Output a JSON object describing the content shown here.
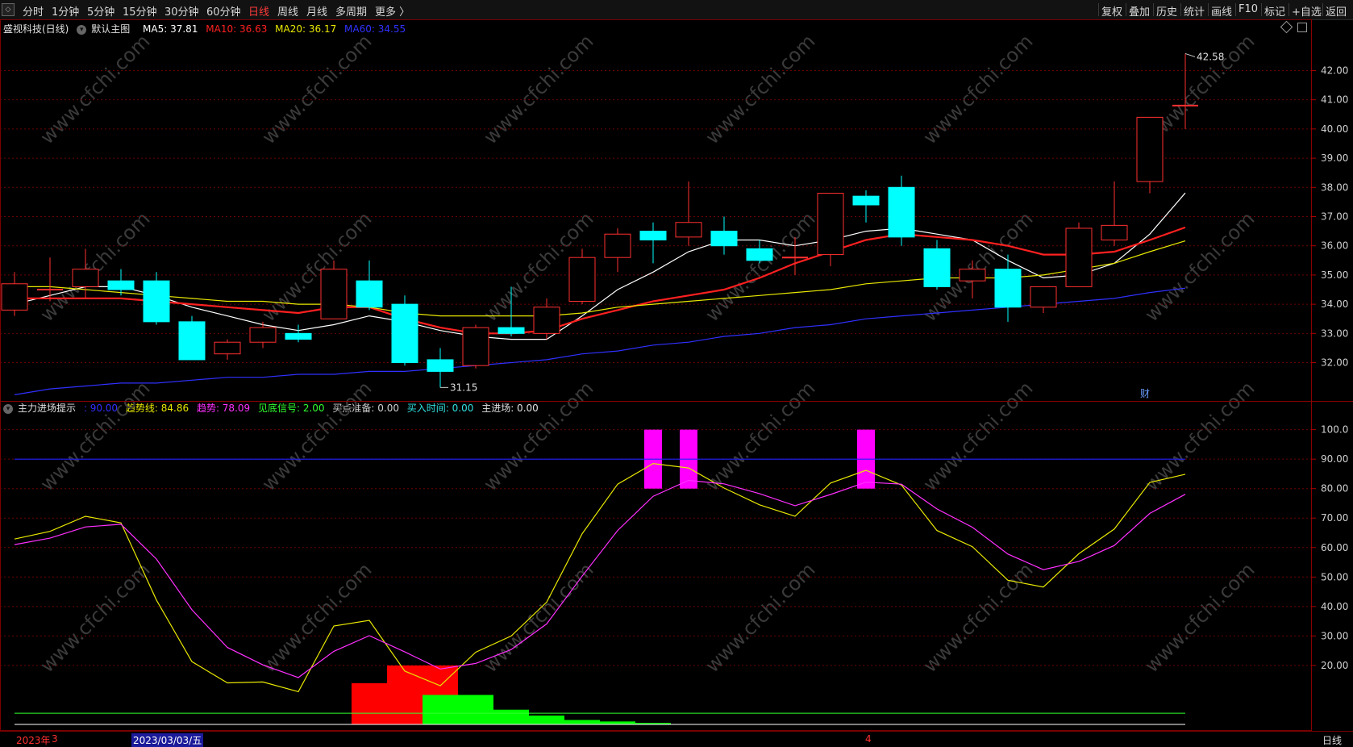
{
  "topbar": {
    "periods": [
      {
        "label": "分时",
        "active": false
      },
      {
        "label": "1分钟",
        "active": false
      },
      {
        "label": "5分钟",
        "active": false
      },
      {
        "label": "15分钟",
        "active": false
      },
      {
        "label": "30分钟",
        "active": false
      },
      {
        "label": "60分钟",
        "active": false
      },
      {
        "label": "日线",
        "active": true
      },
      {
        "label": "周线",
        "active": false
      },
      {
        "label": "月线",
        "active": false
      },
      {
        "label": "多周期",
        "active": false
      },
      {
        "label": "更多 〉",
        "active": false
      }
    ],
    "right_buttons": [
      "复权",
      "叠加",
      "历史",
      "统计",
      "画线",
      "F10",
      "标记",
      "+自选",
      "返回"
    ]
  },
  "main_legend": {
    "stock": "盛视科技(日线)",
    "template": "默认主图",
    "ma5": "MA5: 37.81",
    "ma10": "MA10: 36.63",
    "ma20": "MA20: 36.17",
    "ma60": "MA60: 34.55",
    "colors": {
      "ma5": "#ffffff",
      "ma10": "#ff2020",
      "ma20": "#e8e800",
      "ma60": "#3030ff"
    }
  },
  "indicator_legend": {
    "name": "主力进场提示",
    "level": ": 90.00",
    "trend_line": "趋势线: 84.86",
    "trend": "趋势: 78.09",
    "bottom_signal": "见底信号: 2.00",
    "buy_prep": "买点准备: 0.00",
    "buy_time": "买入时间: 0.00",
    "main_entry": "主进场: 0.00"
  },
  "annotations": {
    "high": "42.58",
    "low": "31.15",
    "cai": "财"
  },
  "watermark": "www.cfchi.com",
  "bottombar": {
    "year": "2023年",
    "m3": "3",
    "date": "2023/03/03/五",
    "m4": "4",
    "period": "日线"
  },
  "chart_data": [
    {
      "type": "candlestick",
      "title": "盛视科技(日线)",
      "y_ticks": [
        "32.00",
        "33.00",
        "34.00",
        "35.00",
        "36.00",
        "37.00",
        "38.00",
        "39.00",
        "40.00",
        "41.00",
        "42.00"
      ],
      "ylim": [
        30.8,
        43.2
      ],
      "candles": [
        {
          "o": 33.8,
          "h": 35.1,
          "l": 33.6,
          "c": 34.7
        },
        {
          "o": 34.5,
          "h": 35.6,
          "l": 34.1,
          "c": 34.5
        },
        {
          "o": 34.6,
          "h": 35.9,
          "l": 34.2,
          "c": 35.2
        },
        {
          "o": 34.8,
          "h": 35.2,
          "l": 34.3,
          "c": 34.5
        },
        {
          "o": 34.8,
          "h": 35.1,
          "l": 33.3,
          "c": 33.4
        },
        {
          "o": 33.4,
          "h": 33.6,
          "l": 32.1,
          "c": 32.1
        },
        {
          "o": 32.3,
          "h": 32.8,
          "l": 32.1,
          "c": 32.7
        },
        {
          "o": 32.7,
          "h": 33.4,
          "l": 32.5,
          "c": 33.2
        },
        {
          "o": 33.0,
          "h": 33.3,
          "l": 32.7,
          "c": 32.8
        },
        {
          "o": 33.5,
          "h": 35.5,
          "l": 33.5,
          "c": 35.2
        },
        {
          "o": 34.8,
          "h": 35.5,
          "l": 33.8,
          "c": 33.9
        },
        {
          "o": 34.0,
          "h": 34.3,
          "l": 31.9,
          "c": 32.0
        },
        {
          "o": 32.1,
          "h": 32.5,
          "l": 31.15,
          "c": 31.7
        },
        {
          "o": 31.9,
          "h": 33.3,
          "l": 31.8,
          "c": 33.2
        },
        {
          "o": 33.2,
          "h": 34.6,
          "l": 32.9,
          "c": 33.0
        },
        {
          "o": 33.0,
          "h": 34.2,
          "l": 32.8,
          "c": 33.9
        },
        {
          "o": 34.1,
          "h": 35.9,
          "l": 34.0,
          "c": 35.6
        },
        {
          "o": 35.6,
          "h": 36.6,
          "l": 35.1,
          "c": 36.4
        },
        {
          "o": 36.5,
          "h": 36.8,
          "l": 35.4,
          "c": 36.2
        },
        {
          "o": 36.3,
          "h": 38.2,
          "l": 36.0,
          "c": 36.8
        },
        {
          "o": 36.5,
          "h": 37.0,
          "l": 35.7,
          "c": 36.0
        },
        {
          "o": 35.9,
          "h": 36.2,
          "l": 35.4,
          "c": 35.5
        },
        {
          "o": 35.6,
          "h": 36.3,
          "l": 35.0,
          "c": 35.6
        },
        {
          "o": 35.7,
          "h": 37.8,
          "l": 35.3,
          "c": 37.8
        },
        {
          "o": 37.7,
          "h": 37.9,
          "l": 36.8,
          "c": 37.4
        },
        {
          "o": 38.0,
          "h": 38.4,
          "l": 36.0,
          "c": 36.3
        },
        {
          "o": 35.9,
          "h": 36.2,
          "l": 34.5,
          "c": 34.6
        },
        {
          "o": 34.8,
          "h": 35.5,
          "l": 34.2,
          "c": 35.2
        },
        {
          "o": 35.2,
          "h": 35.7,
          "l": 33.4,
          "c": 33.9
        },
        {
          "o": 33.9,
          "h": 34.6,
          "l": 33.7,
          "c": 34.6
        },
        {
          "o": 34.6,
          "h": 36.8,
          "l": 34.6,
          "c": 36.6
        },
        {
          "o": 36.2,
          "h": 38.2,
          "l": 36.0,
          "c": 36.7
        },
        {
          "o": 38.2,
          "h": 40.4,
          "l": 37.8,
          "c": 40.4
        },
        {
          "o": 40.8,
          "h": 42.58,
          "l": 40.0,
          "c": 40.8
        }
      ],
      "series": [
        {
          "name": "MA5",
          "values": [
            34.0,
            34.3,
            34.6,
            34.6,
            34.3,
            33.9,
            33.6,
            33.3,
            33.1,
            33.3,
            33.6,
            33.4,
            33.1,
            32.9,
            32.8,
            32.8,
            33.6,
            34.5,
            35.1,
            35.8,
            36.2,
            36.2,
            36.0,
            36.2,
            36.5,
            36.6,
            36.4,
            36.2,
            35.5,
            34.9,
            35.0,
            35.4,
            36.4,
            37.81
          ]
        },
        {
          "name": "MA10",
          "values": [
            34.2,
            34.2,
            34.2,
            34.2,
            34.1,
            34.0,
            33.9,
            33.8,
            33.7,
            33.9,
            33.9,
            33.5,
            33.2,
            33.0,
            33.0,
            33.1,
            33.5,
            33.8,
            34.1,
            34.3,
            34.5,
            34.9,
            35.4,
            35.8,
            36.2,
            36.4,
            36.3,
            36.2,
            36.0,
            35.7,
            35.7,
            35.8,
            36.2,
            36.63
          ]
        },
        {
          "name": "MA20",
          "values": [
            34.6,
            34.6,
            34.5,
            34.4,
            34.3,
            34.2,
            34.1,
            34.1,
            34.0,
            34.0,
            33.9,
            33.7,
            33.6,
            33.6,
            33.6,
            33.6,
            33.7,
            33.9,
            34.0,
            34.1,
            34.2,
            34.3,
            34.4,
            34.5,
            34.7,
            34.8,
            34.9,
            34.9,
            34.9,
            35.0,
            35.2,
            35.4,
            35.8,
            36.17
          ]
        },
        {
          "name": "MA60",
          "values": [
            30.9,
            31.1,
            31.2,
            31.3,
            31.3,
            31.4,
            31.5,
            31.5,
            31.6,
            31.6,
            31.7,
            31.7,
            31.8,
            31.9,
            32.0,
            32.1,
            32.3,
            32.4,
            32.6,
            32.7,
            32.9,
            33.0,
            33.2,
            33.3,
            33.5,
            33.6,
            33.7,
            33.8,
            33.9,
            34.0,
            34.1,
            34.2,
            34.4,
            34.55
          ]
        }
      ]
    },
    {
      "type": "line",
      "title": "主力进场提示",
      "y_ticks": [
        "20.00",
        "30.00",
        "40.00",
        "50.00",
        "60.00",
        "70.00",
        "80.00",
        "90.00",
        "100.0"
      ],
      "ylim": [
        0,
        104
      ],
      "series": [
        {
          "name": "趋势线",
          "values": [
            62.9,
            65.5,
            70.6,
            68.4,
            42.2,
            21.3,
            14.1,
            14.4,
            11.1,
            33.4,
            35.3,
            18.1,
            13.1,
            24.5,
            30.0,
            41.5,
            64.7,
            81.5,
            88.5,
            87.0,
            80.2,
            74.5,
            70.6,
            81.9,
            86.2,
            81.2,
            65.8,
            60.3,
            48.9,
            46.6,
            57.9,
            66.3,
            82.1,
            84.86
          ]
        },
        {
          "name": "趋势",
          "values": [
            61.0,
            63.2,
            67.0,
            67.9,
            56.1,
            38.9,
            26.1,
            20.2,
            15.9,
            24.8,
            30.1,
            24.6,
            18.8,
            20.7,
            25.4,
            34.1,
            50.3,
            65.8,
            77.4,
            82.8,
            81.6,
            78.3,
            74.2,
            78.0,
            82.2,
            81.5,
            73.1,
            66.9,
            57.8,
            52.5,
            55.3,
            60.7,
            71.6,
            78.09
          ]
        },
        {
          "name": "主力进场提示",
          "values": [
            90,
            90,
            90,
            90,
            90,
            90,
            90,
            90,
            90,
            90,
            90,
            90,
            90,
            90,
            90,
            90,
            90,
            90,
            90,
            90,
            90,
            90,
            90,
            90,
            90,
            90,
            90,
            90,
            90,
            90,
            90,
            90,
            90,
            90
          ]
        }
      ],
      "signal_bars": [
        {
          "i": 18,
          "from": 80,
          "to": 100
        },
        {
          "i": 19,
          "from": 80,
          "to": 100
        },
        {
          "i": 24,
          "from": 80,
          "to": 100
        }
      ],
      "red_blocks": [
        {
          "i": 10,
          "to": 14
        },
        {
          "i": 11,
          "to": 20
        },
        {
          "i": 12,
          "to": 20
        }
      ],
      "green_blocks": [
        {
          "i": 12,
          "to": 10
        },
        {
          "i": 13,
          "to": 10
        },
        {
          "i": 14,
          "to": 5
        },
        {
          "i": 15,
          "to": 3
        },
        {
          "i": 16,
          "to": 1.5
        },
        {
          "i": 17,
          "to": 1
        },
        {
          "i": 18,
          "to": 0.5
        }
      ],
      "baseline": 3.8
    }
  ]
}
